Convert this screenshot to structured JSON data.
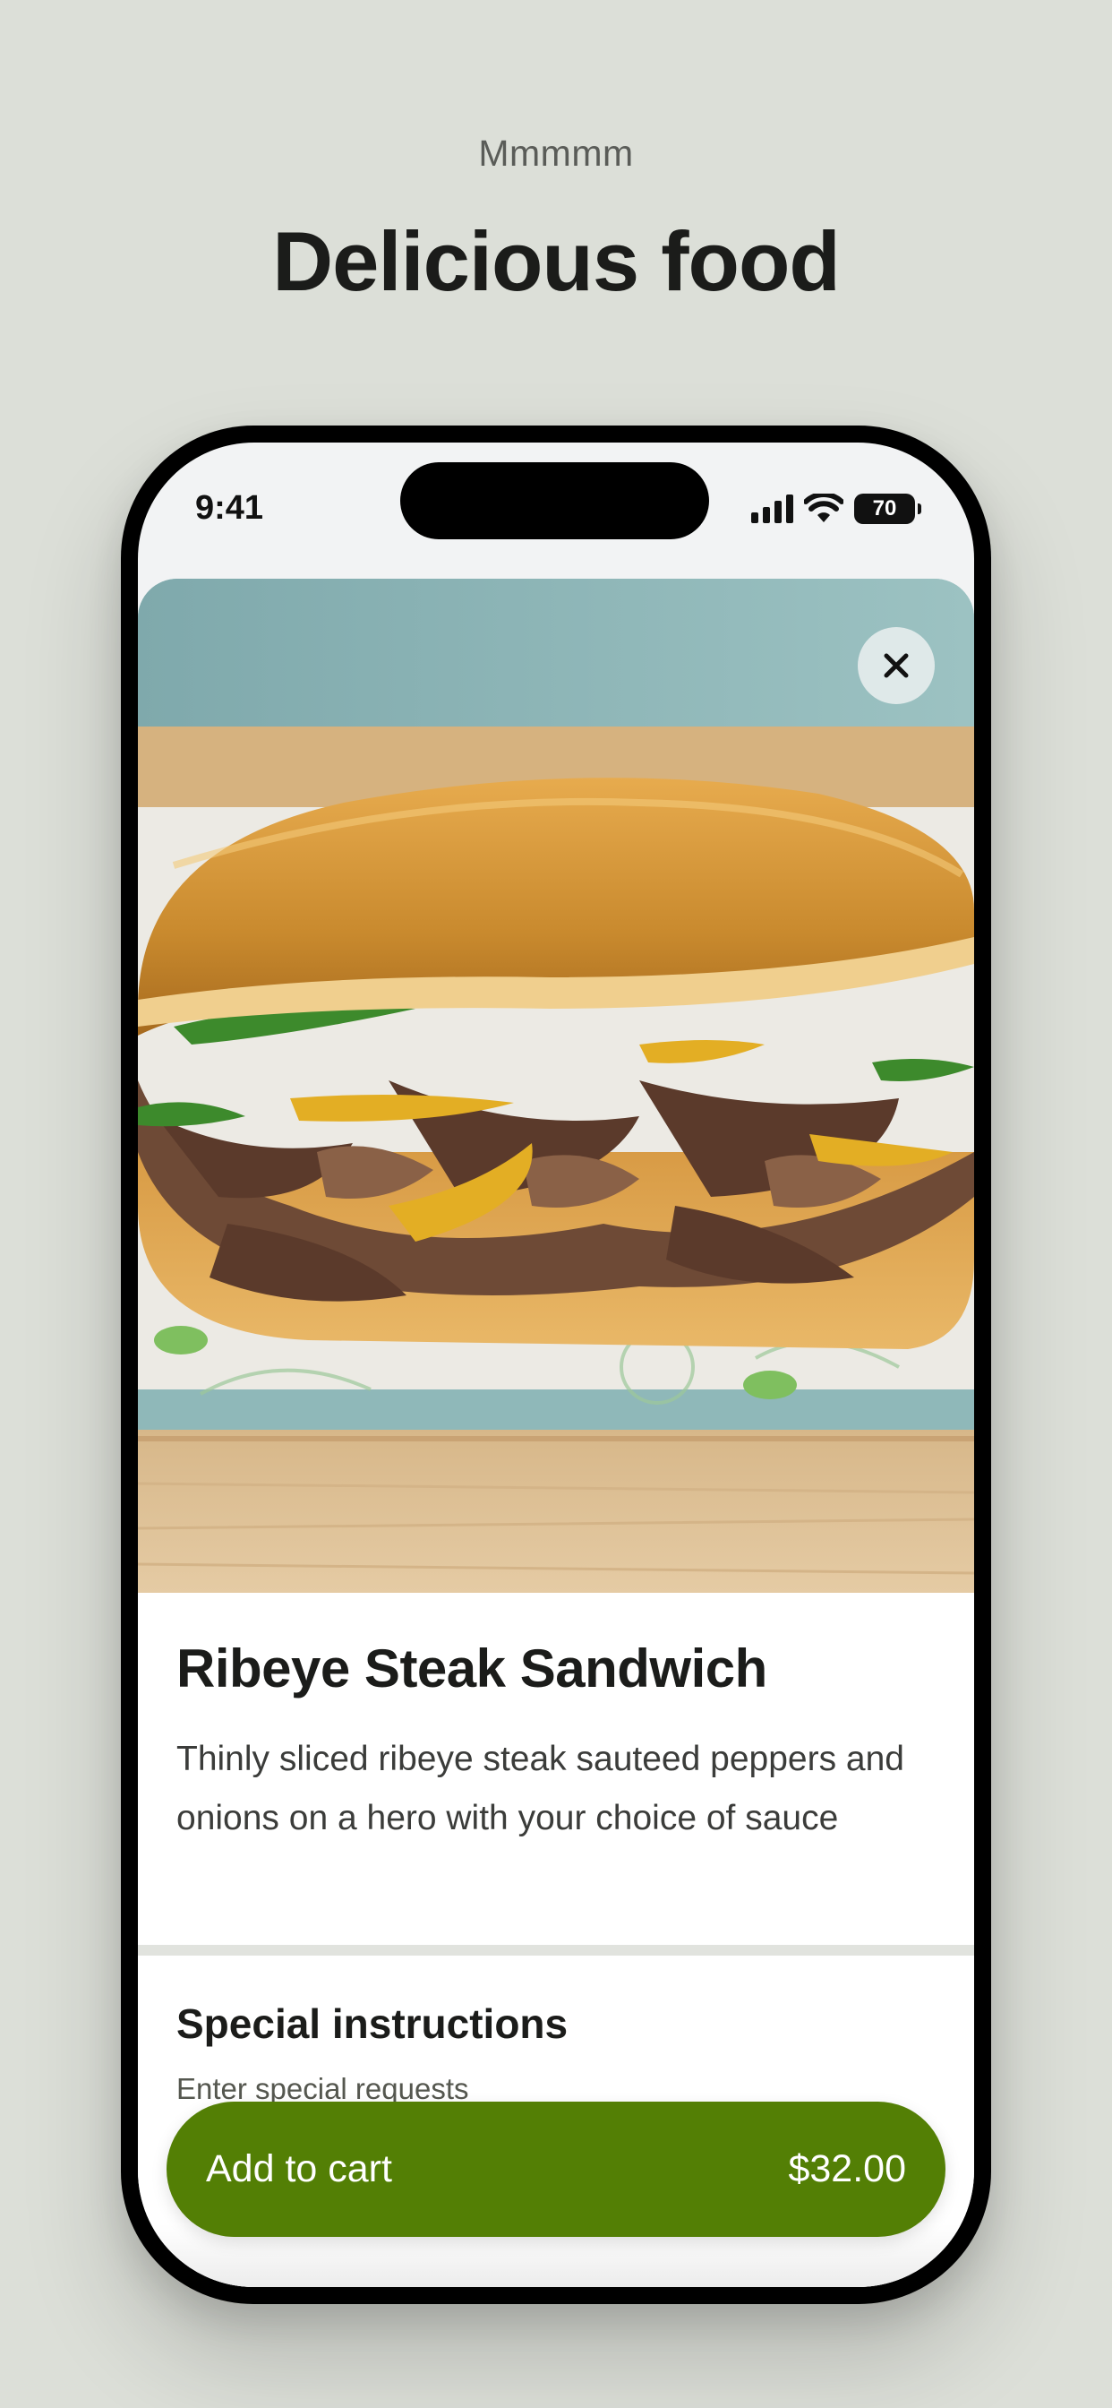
{
  "header": {
    "eyebrow": "Mmmmm",
    "headline": "Delicious food"
  },
  "status_bar": {
    "time": "9:41",
    "battery_level": "70",
    "icons": [
      "signal-icon",
      "wifi-icon",
      "battery-icon"
    ]
  },
  "product": {
    "image_description_icon": "sandwich-photo",
    "close_icon": "close-icon",
    "title": "Ribeye Steak Sandwich",
    "description": "Thinly sliced ribeye steak sauteed peppers and onions on a hero with your choice of sauce"
  },
  "special_instructions": {
    "title": "Special instructions",
    "placeholder": "Enter special requests"
  },
  "cart": {
    "label": "Add to cart",
    "price": "$32.00",
    "accent_color": "#537f05"
  }
}
